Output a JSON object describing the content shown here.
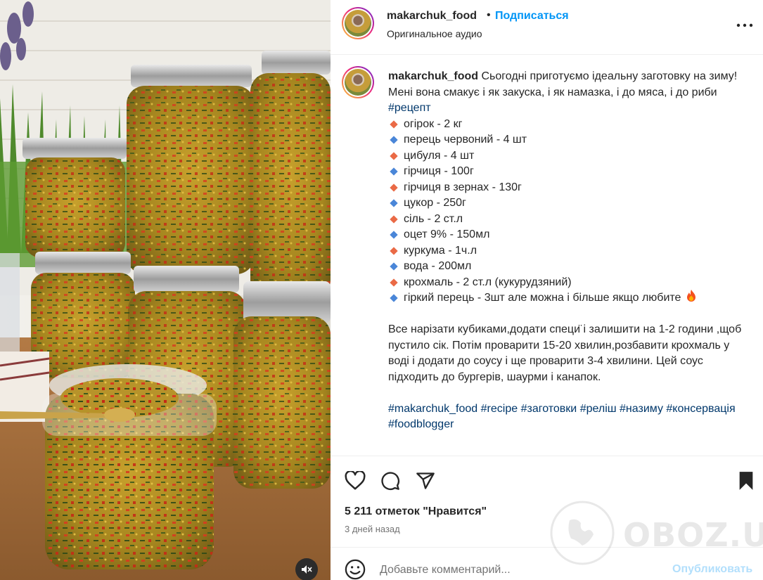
{
  "media": {
    "mute_icon": "speaker-muted-icon"
  },
  "header": {
    "username": "makarchuk_food",
    "separator": "•",
    "follow_label": "Подписаться",
    "audio_label": "Оригинальное аудио",
    "more_icon": "more-horizontal-icon"
  },
  "caption": {
    "username": "makarchuk_food",
    "intro": " Сьогодні приготуємо ідеальну заготовку на зиму! Мені вона смакує і як закуска, і як намазка, і до мяса, і до риби",
    "recipe_tag": "#рецепт",
    "ingredients": [
      {
        "text": "огірок - 2 кг",
        "color": "#ea6a46"
      },
      {
        "text": "перець червоний - 4 шт",
        "color": "#4a86d8"
      },
      {
        "text": "цибуля - 4 шт",
        "color": "#ea6a46"
      },
      {
        "text": "гірчиця - 100г",
        "color": "#4a86d8"
      },
      {
        "text": "гірчиця в зернах - 130г",
        "color": "#ea6a46"
      },
      {
        "text": "цукор - 250г",
        "color": "#4a86d8"
      },
      {
        "text": "сіль - 2 ст.л",
        "color": "#ea6a46"
      },
      {
        "text": "оцет 9% - 150мл",
        "color": "#4a86d8"
      },
      {
        "text": "куркума - 1ч.л",
        "color": "#ea6a46"
      },
      {
        "text": "вода - 200мл",
        "color": "#4a86d8"
      },
      {
        "text": "крохмаль - 2 ст.л (кукурудзяний)",
        "color": "#ea6a46"
      },
      {
        "text": "гіркий перець - 3шт але можна і більше якщо любите",
        "color": "#4a86d8"
      }
    ],
    "fire_icon": "fire-emoji-icon",
    "instructions": "Все нарізати кубиками,додати специ͏̈ і залишити на 1-2 години ,щоб пустило сік. Потім проварити 15-20 хвилин,розбавити крохмаль у воді і додати до соусу і ще проварити 3-4 хвилини. Цей соус підходить до бургерів, шаурми і канапок.",
    "hashtags": [
      "#makarchuk_food",
      "#recipe",
      "#заготовки",
      "#реліш",
      "#назиму",
      "#консервація",
      "#foodblogger"
    ]
  },
  "actions": {
    "like_icon": "heart-icon",
    "comment_icon": "comment-icon",
    "share_icon": "share-icon",
    "save_icon": "bookmark-icon",
    "likes_text": "5 211 отметок \"Нравится\"",
    "date_text": "3 дней назад"
  },
  "comment": {
    "emoji_icon": "emoji-icon",
    "placeholder": "Добавьте комментарий...",
    "publish_label": "Опубликовать"
  },
  "watermark": {
    "text": "OBOZ.UA"
  },
  "colors": {
    "follow_blue": "#0095f6",
    "hashtag_blue": "#00376b",
    "publish_disabled": "#b2dffc"
  }
}
